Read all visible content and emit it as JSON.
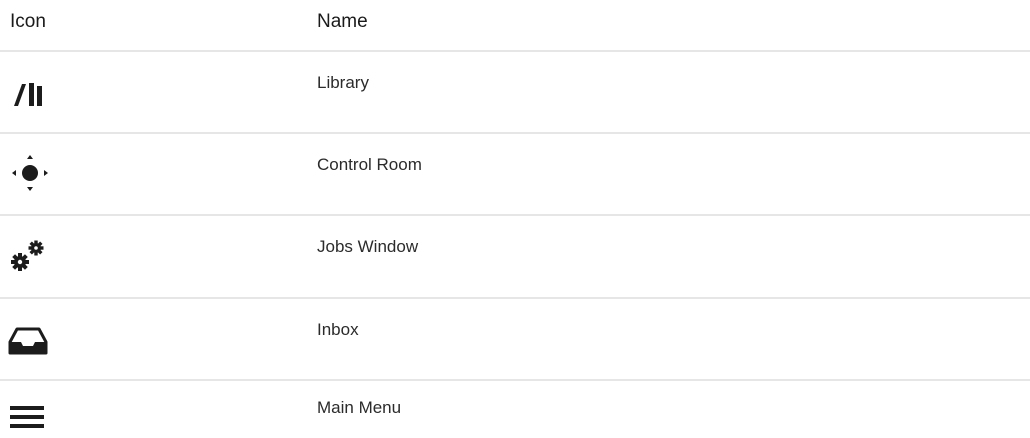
{
  "table": {
    "headers": {
      "icon": "Icon",
      "name": "Name"
    },
    "rows": [
      {
        "icon": "library-icon",
        "name": "Library"
      },
      {
        "icon": "control-room-icon",
        "name": "Control Room"
      },
      {
        "icon": "jobs-window-icon",
        "name": "Jobs Window"
      },
      {
        "icon": "inbox-icon",
        "name": "Inbox"
      },
      {
        "icon": "main-menu-icon",
        "name": "Main Menu"
      }
    ]
  }
}
